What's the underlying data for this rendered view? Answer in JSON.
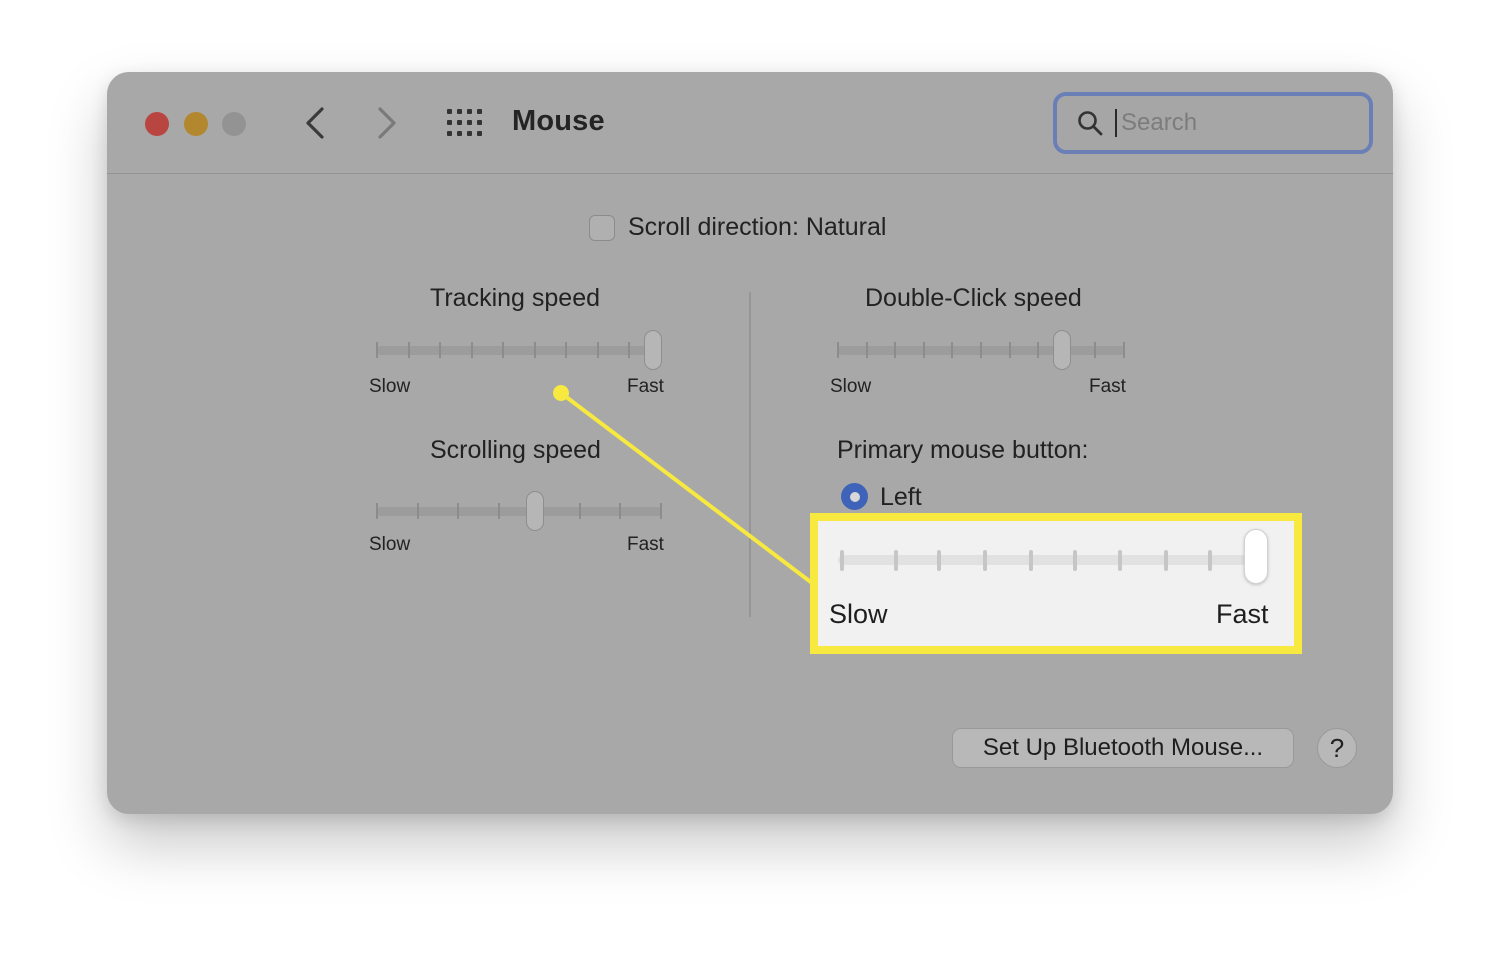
{
  "window": {
    "title": "Mouse"
  },
  "search": {
    "placeholder": "Search"
  },
  "scroll_direction": {
    "label": "Scroll direction: Natural",
    "checked": false
  },
  "tracking_speed": {
    "label": "Tracking speed",
    "min_label": "Slow",
    "max_label": "Fast",
    "value": 1.0
  },
  "scrolling_speed": {
    "label": "Scrolling speed",
    "min_label": "Slow",
    "max_label": "Fast",
    "value": 0.56
  },
  "double_click_speed": {
    "label": "Double-Click speed",
    "min_label": "Slow",
    "max_label": "Fast",
    "value": 0.8
  },
  "primary_button": {
    "label": "Primary mouse button:",
    "selected": "Left"
  },
  "callout": {
    "min_label": "Slow",
    "max_label": "Fast",
    "value": 1.0,
    "highlight_color": "#f7e940"
  },
  "footer": {
    "bluetooth_button": "Set Up Bluetooth Mouse...",
    "help_button": "?"
  },
  "colors": {
    "window_bg": "#a8a8a8",
    "radio_accent": "#3e63b8",
    "search_focus": "#6a7fb6",
    "traffic_red": "#b94541",
    "traffic_yellow": "#b3872d",
    "traffic_gray": "#939393"
  }
}
